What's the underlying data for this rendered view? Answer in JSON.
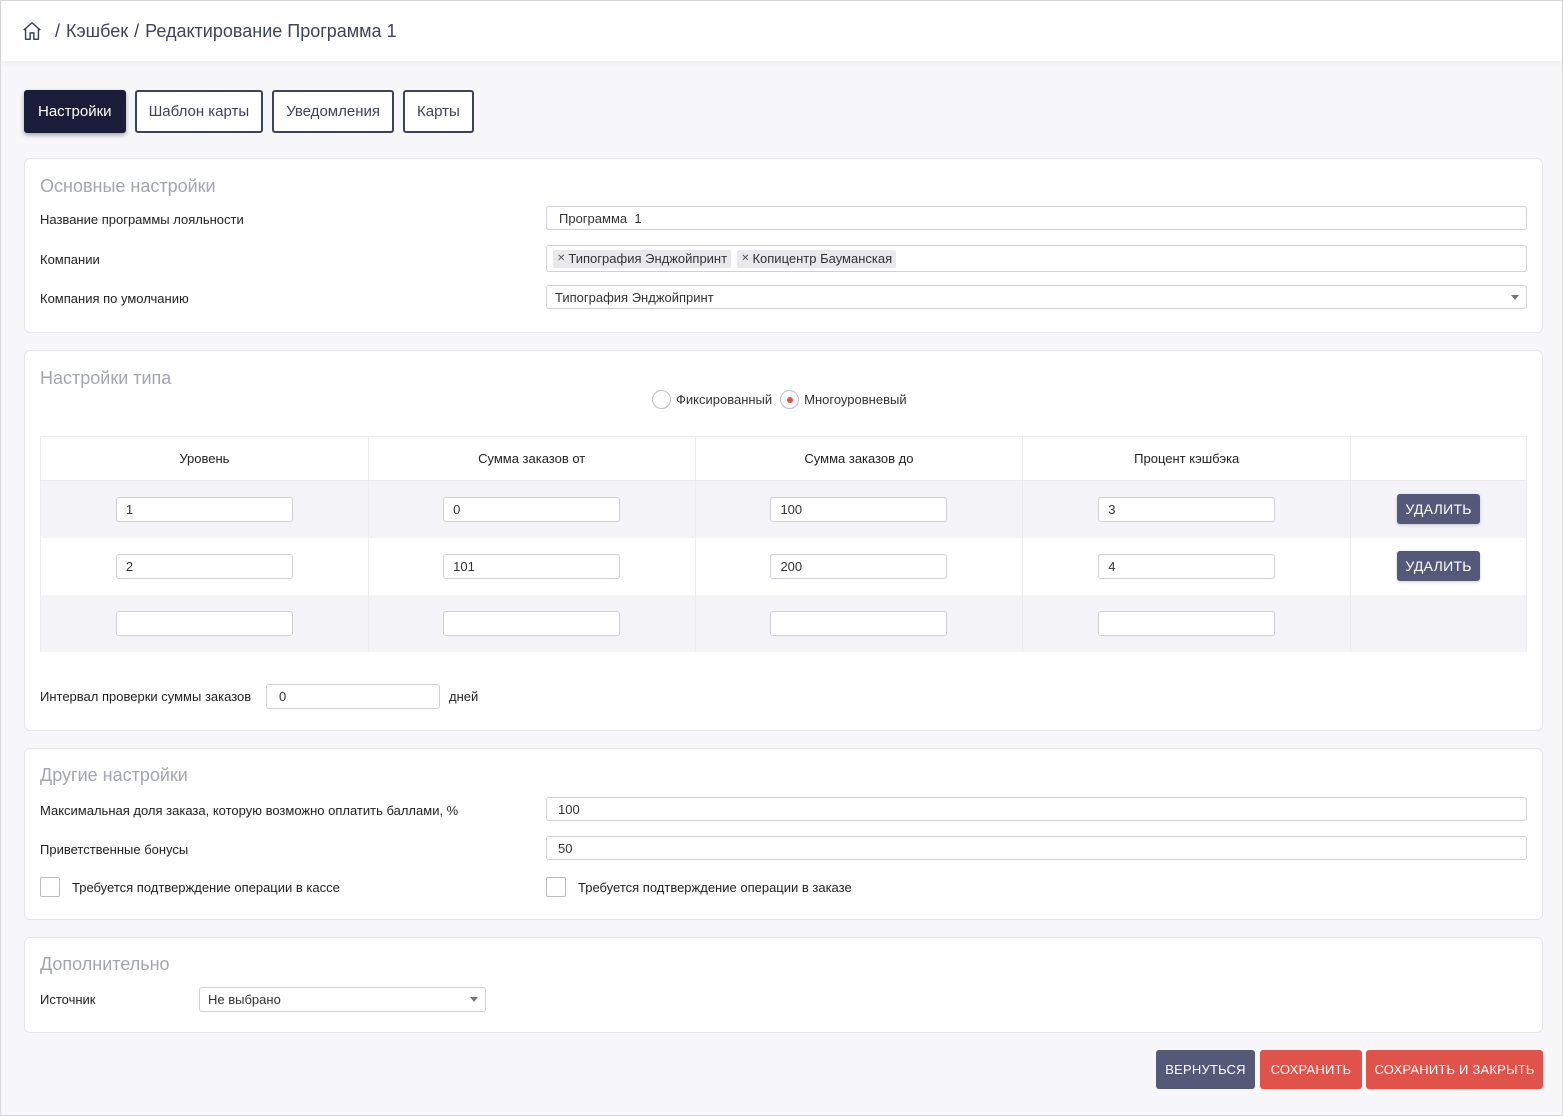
{
  "breadcrumb": {
    "items": [
      "Кэшбек",
      "Редактирование Программа 1"
    ],
    "separator": "/"
  },
  "tabs": [
    {
      "label": "Настройки",
      "active": true
    },
    {
      "label": "Шаблон карты",
      "active": false
    },
    {
      "label": "Уведомления",
      "active": false
    },
    {
      "label": "Карты",
      "active": false
    }
  ],
  "main_settings": {
    "title": "Основные настройки",
    "program_name_label": "Название программы лояльности",
    "program_name_value": "Программа  1",
    "companies_label": "Компании",
    "companies": [
      "Типография Энджойпринт",
      "Копицентр Бауманская"
    ],
    "default_company_label": "Компания по умолчанию",
    "default_company_value": "Типография Энджойпринт"
  },
  "type_settings": {
    "title": "Настройки типа",
    "radio_fixed": "Фиксированный",
    "radio_multilevel": "Многоуровневый",
    "selected": "multilevel",
    "columns": [
      "Уровень",
      "Сумма заказов от",
      "Сумма заказов до",
      "Процент кэшбэка"
    ],
    "rows": [
      {
        "level": "1",
        "from": "0",
        "to": "100",
        "percent": "3",
        "delete_label": "УДАЛИТЬ"
      },
      {
        "level": "2",
        "from": "101",
        "to": "200",
        "percent": "4",
        "delete_label": "УДАЛИТЬ"
      },
      {
        "level": "",
        "from": "",
        "to": "",
        "percent": ""
      }
    ],
    "interval_label": "Интервал проверки суммы заказов",
    "interval_value": "0",
    "interval_unit": "дней"
  },
  "other_settings": {
    "title": "Другие настройки",
    "max_share_label": "Максимальная доля заказа, которую возможно оплатить баллами, %",
    "max_share_value": "100",
    "welcome_bonus_label": "Приветственные бонусы",
    "welcome_bonus_value": "50",
    "confirm_register_label": "Требуется подтверждение операции в кассе",
    "confirm_order_label": "Требуется подтверждение операции в заказе"
  },
  "additional": {
    "title": "Дополнительно",
    "source_label": "Источник",
    "source_value": "Не выбрано"
  },
  "actions": {
    "back": "ВЕРНУТЬСЯ",
    "save": "СОХРАНИТЬ",
    "save_close": "СОХРАНИТЬ И ЗАКРЫТЬ"
  },
  "colors": {
    "primary_dark": "#1b1c3a",
    "slate_button": "#54597a",
    "danger": "#e0534b"
  }
}
